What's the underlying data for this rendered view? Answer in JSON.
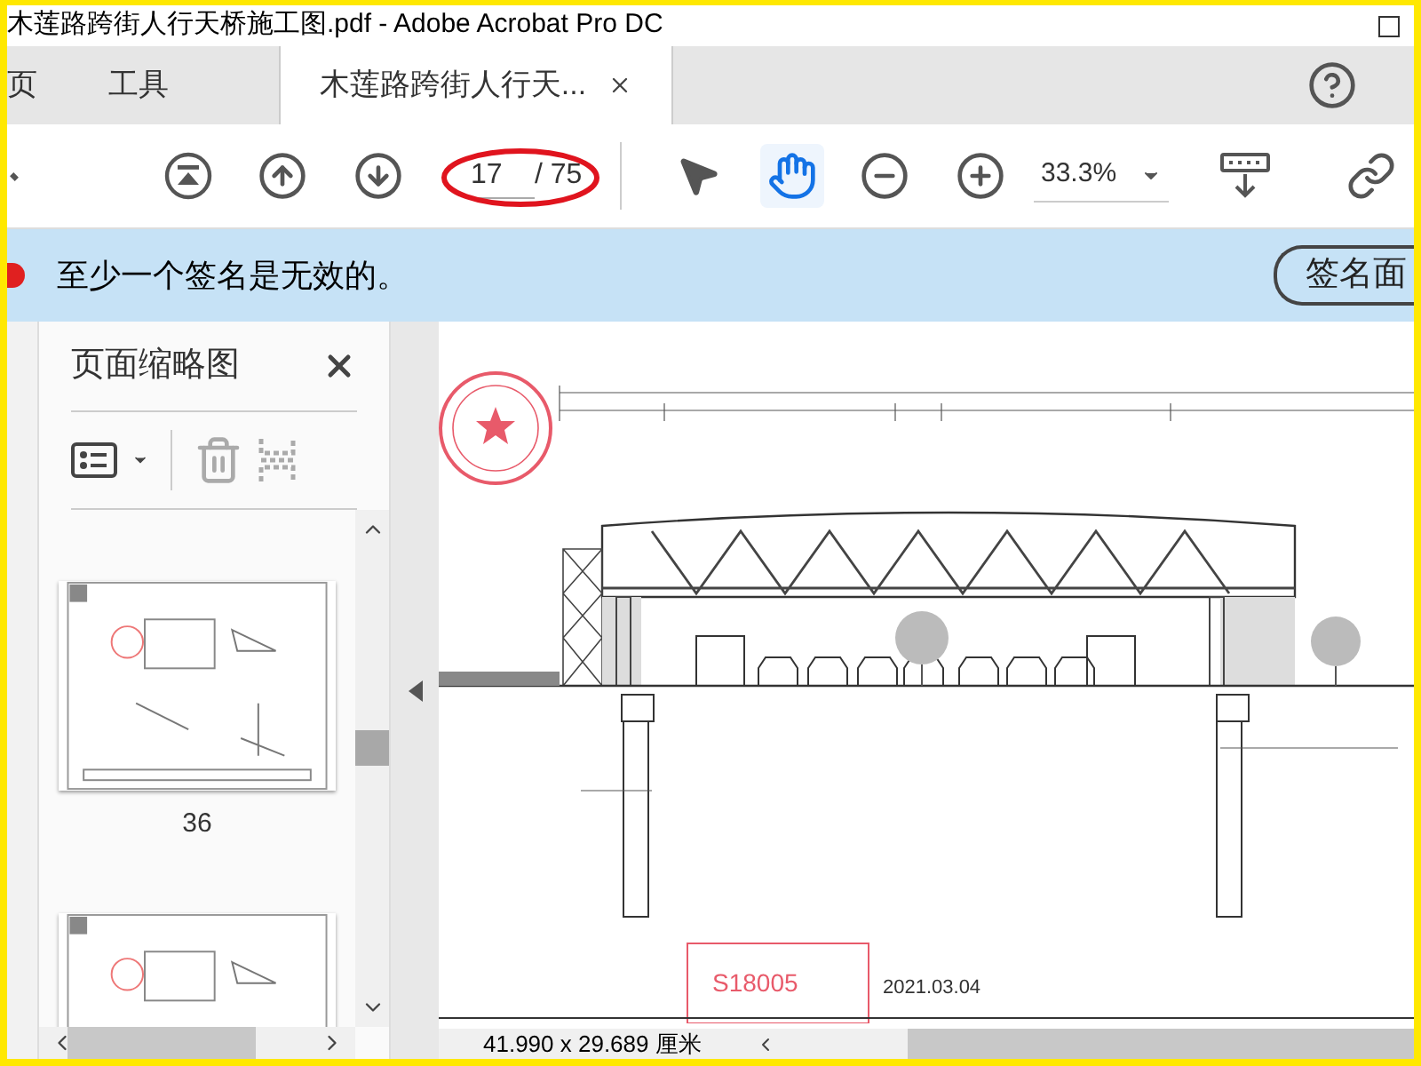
{
  "window": {
    "title": "木莲路跨街人行天桥施工图.pdf - Adobe Acrobat Pro DC"
  },
  "tabs": [
    {
      "label": "页",
      "selected": false
    },
    {
      "label": "工具",
      "selected": false
    },
    {
      "label": "木莲路跨街人行天...",
      "selected": true
    }
  ],
  "toolbar": {
    "page_field": {
      "value": "17",
      "total": "/ 75"
    },
    "tools": [
      {
        "kind": "select",
        "selected": false
      },
      {
        "kind": "hand",
        "selected": true
      }
    ],
    "zoom": {
      "value": "33.3%"
    }
  },
  "banner": {
    "message": "至少一个签名是无效的。",
    "button": "签名面"
  },
  "thumbnails_panel": {
    "title": "页面缩略图",
    "thumbnails": [
      {
        "label": "36"
      }
    ]
  },
  "document": {
    "stamp_code": "S18005",
    "date": "2021.03.04"
  },
  "status_bar": {
    "page_size": "41.990 x 29.689 厘米"
  }
}
